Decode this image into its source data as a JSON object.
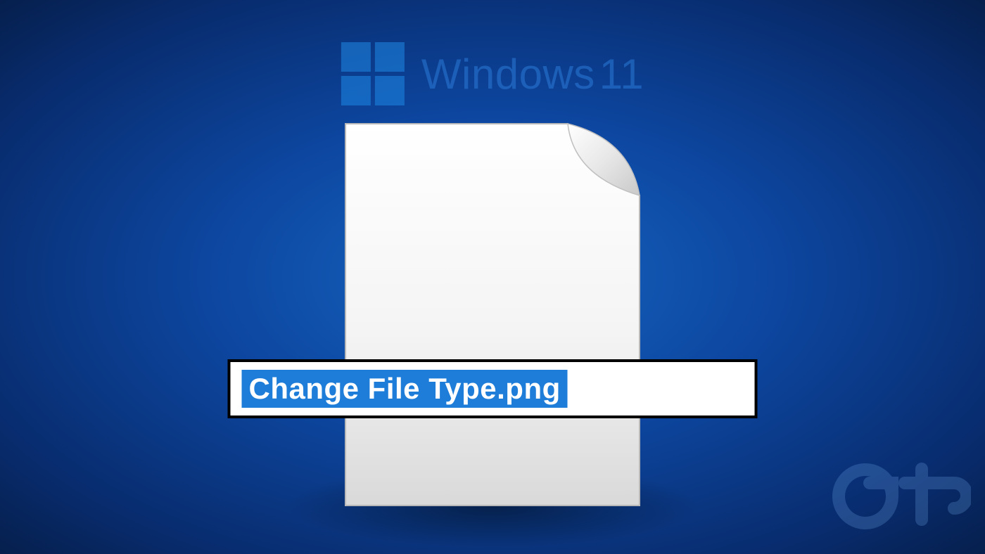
{
  "header": {
    "brand_text": "Windows",
    "version": "11"
  },
  "file": {
    "rename_value": "Change File Type.png"
  },
  "watermark": {
    "label": "Gt"
  }
}
